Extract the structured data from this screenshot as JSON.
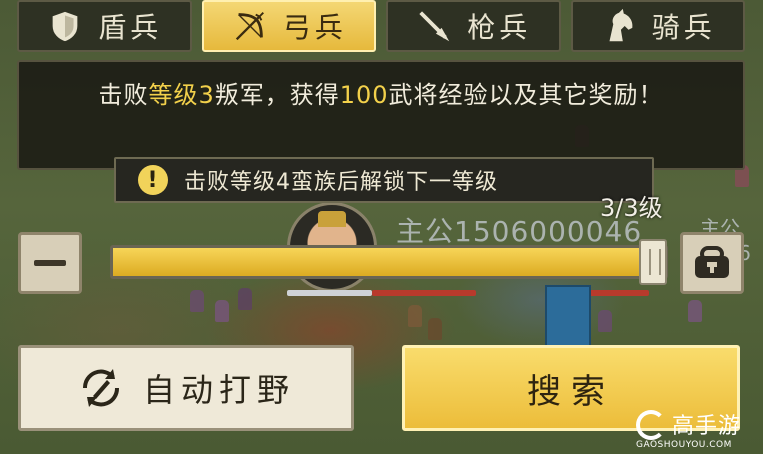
{
  "tabs": [
    {
      "label": "盾兵",
      "icon": "shield-icon",
      "active": false
    },
    {
      "label": "弓兵",
      "icon": "bow-icon",
      "active": true
    },
    {
      "label": "枪兵",
      "icon": "spear-icon",
      "active": false
    },
    {
      "label": "骑兵",
      "icon": "horse-icon",
      "active": false
    }
  ],
  "description": {
    "part1": "击败",
    "highlight1": "等级3",
    "part2": "叛军，获得",
    "highlight2": "100",
    "part3": "武将经验以及其它奖励！"
  },
  "hint": {
    "icon": "!",
    "text": "击败等级4蛮族后解锁下一等级"
  },
  "level_indicator": "3/3级",
  "player_name": "主公1506000046",
  "player_name_partial": "主公1506",
  "slider": {
    "value": 3,
    "max": 3,
    "fill_fraction": 1.0
  },
  "buttons": {
    "auto": "自动打野",
    "search": "搜索"
  },
  "watermark": {
    "brand": "高手游",
    "url": "GAOSHOUYOU.COM"
  },
  "colors": {
    "accent": "#f3d14b",
    "panel": "#1e1e16",
    "button_light": "#efe9d8"
  }
}
